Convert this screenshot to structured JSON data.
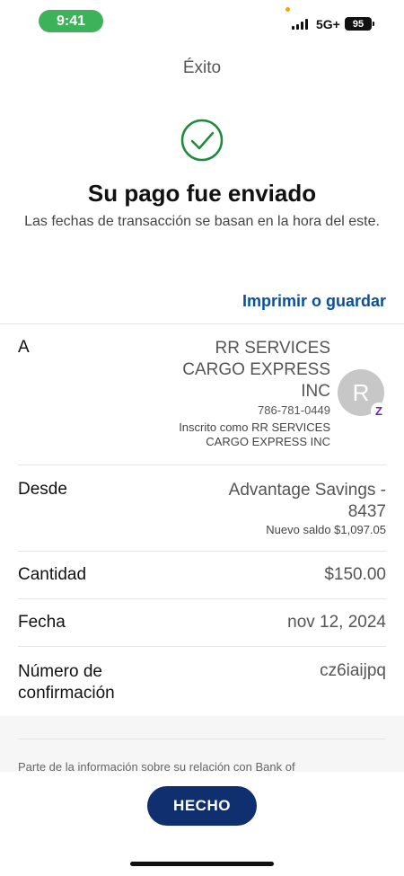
{
  "status_bar": {
    "time": "9:41",
    "network": "5G+",
    "battery": "95"
  },
  "header": {
    "title": "Éxito"
  },
  "confirmation": {
    "icon": "check-circle-icon",
    "icon_color": "#1e8a3c",
    "headline": "Su pago fue enviado",
    "subtext": "Las fechas de transacción se basan en la hora del este."
  },
  "print_link": "Imprimir o guardar",
  "details": {
    "to": {
      "label": "A",
      "name": "RR SERVICES CARGO EXPRESS INC",
      "phone": "786-781-0449",
      "enrolled": "Inscrito como RR SERVICES CARGO EXPRESS INC",
      "avatar_initial": "R",
      "badge": "Z"
    },
    "from": {
      "label": "Desde",
      "account": "Advantage Savings - 8437",
      "balance": "Nuevo saldo $1,097.05"
    },
    "amount": {
      "label": "Cantidad",
      "value": "$150.00"
    },
    "date": {
      "label": "Fecha",
      "value": "nov 12, 2024"
    },
    "confirmation_number": {
      "label": "Número de confirmación",
      "value": "cz6iaijpq"
    }
  },
  "disclaimer": "Parte de la información sobre su relación con Bank of",
  "footer": {
    "done_label": "HECHO"
  },
  "colors": {
    "accent_link": "#0a4fa0",
    "primary_button": "#0f2f6e",
    "status_time_pill": "#3db25a"
  }
}
